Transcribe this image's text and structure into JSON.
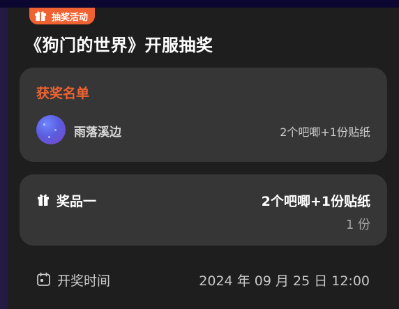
{
  "badge": {
    "label": "抽奖活动",
    "icon": "gift-box-icon",
    "color": "#f06232"
  },
  "title": "《狗门的世界》开服抽奖",
  "winners": {
    "heading": "获奖名单",
    "items": [
      {
        "name": "雨落溪边",
        "prize": "2个吧唧+1份贴纸",
        "avatar": "galaxy-avatar"
      }
    ]
  },
  "prize": {
    "icon": "gift-icon",
    "name": "奖品一",
    "description": "2个吧唧+1份贴纸",
    "quantity": "1 份"
  },
  "draw": {
    "icon": "calendar-icon",
    "label": "开奖时间",
    "time": "2024 年 09 月 25 日 12:00"
  },
  "colors": {
    "accent": "#f06232",
    "card": "#363636",
    "background": "#1e1e1e"
  }
}
